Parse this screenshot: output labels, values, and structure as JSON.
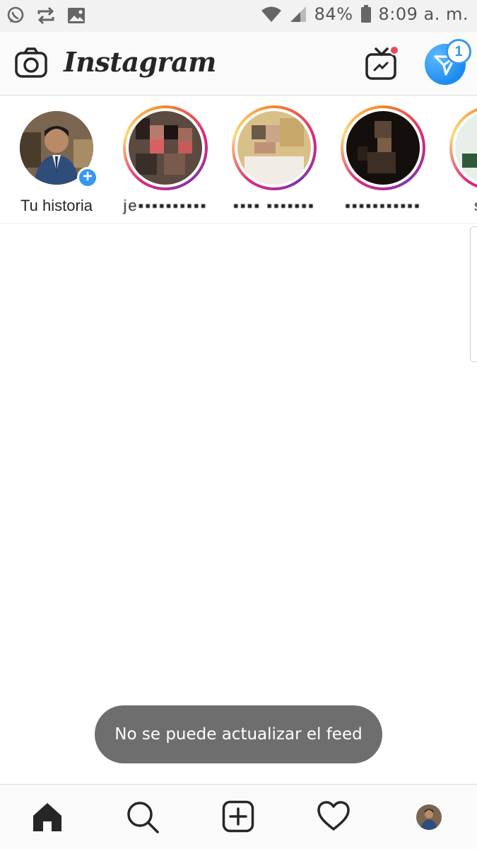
{
  "status_bar": {
    "icons_left": [
      "whatsapp-icon",
      "sync-icon",
      "image-icon"
    ],
    "battery": "84%",
    "time": "8:09 a. m."
  },
  "header": {
    "logo": "Instagram",
    "dm_badge": "1"
  },
  "stories": [
    {
      "label": "Tu historia",
      "own": true
    },
    {
      "label": "je▪▪▪▪▪▪▪▪▪▪",
      "own": false
    },
    {
      "label": "▪▪▪▪ ▪▪▪▪▪▪▪",
      "own": false
    },
    {
      "label": "▪▪▪▪▪▪▪▪▪▪▪",
      "own": false
    },
    {
      "label": "say▪",
      "own": false
    }
  ],
  "toast": {
    "message": "No se puede actualizar el feed"
  },
  "bottom_nav": {
    "items": [
      "home-icon",
      "search-icon",
      "add-post-icon",
      "activity-heart-icon",
      "profile-avatar"
    ]
  },
  "colors": {
    "accent_blue": "#3897f0",
    "notification_red": "#ed4956",
    "toast_bg": "#6e6e6e"
  }
}
